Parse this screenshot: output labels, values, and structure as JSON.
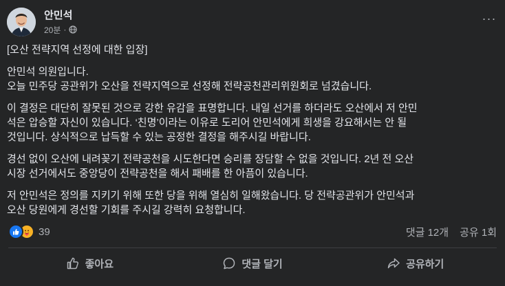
{
  "post": {
    "author": "안민석",
    "time": "20분",
    "more_label": "···",
    "privacy_icon": "globe-icon"
  },
  "content": {
    "title": "[오산 전략지역 선정에 대한 입장]",
    "p1_lines": [
      "안민석 의원입니다.",
      "오늘 민주당 공관위가 오산을 전략지역으로 선정해 전략공천관리위원회로 넘겼습니다."
    ],
    "p2_lines": [
      "이 결정은 대단히 잘못된 것으로 강한 유감을 표명합니다. 내일 선거를 하더라도 오산에서 저 안민",
      "석은 압승할 자신이 있습니다. ‘친명’이라는 이유로 도리어 안민석에게 희생을 강요해서는 안 될",
      "것입니다. 상식적으로 납득할 수 있는 공정한 결정을 해주시길 바랍니다."
    ],
    "p3_lines": [
      "경선 없이 오산에 내려꽂기 전략공천을 시도한다면 승리를 장담할 수 없을 것입니다. 2년 전 오산",
      "시장 선거에서도 중앙당이 전략공천을 해서 패배를 한 아픔이 있습니다."
    ],
    "p4_lines": [
      "저 안민석은 정의를 지키기 위해 또한 당을 위해 열심히 일해왔습니다. 당 전략공관위가 안민석과",
      "오산 당원에게 경선할 기회를 주시길 강력히 요청합니다."
    ]
  },
  "engagement": {
    "reaction_count": "39",
    "comments": "댓글 12개",
    "shares": "공유 1회"
  },
  "actions": {
    "like": "좋아요",
    "comment": "댓글 달기",
    "share": "공유하기"
  },
  "colors": {
    "background": "#242526",
    "text": "#e4e6eb",
    "secondary": "#b0b3b8",
    "like_blue": "#1877f2",
    "care_yellow": "#f7b125"
  }
}
